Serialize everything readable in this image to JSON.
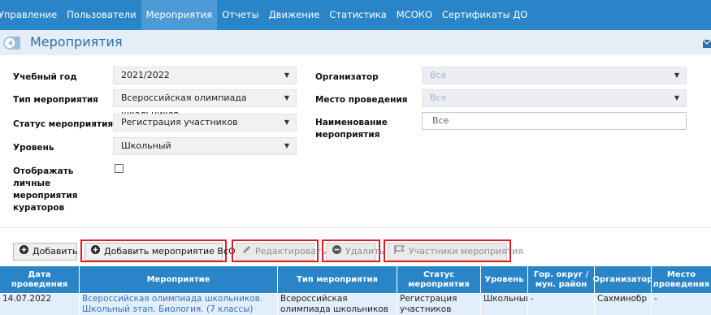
{
  "nav": {
    "items": [
      "Управление",
      "Пользователи",
      "Мероприятия",
      "Отчеты",
      "Движение",
      "Статистика",
      "МСОКО",
      "Сертификаты ДО"
    ],
    "active_index": 2
  },
  "page": {
    "title": "Мероприятия"
  },
  "filters": {
    "year_label": "Учебный год",
    "year_value": "2021/2022",
    "type_label": "Тип мероприятия",
    "type_value": "Всероссийская олимпиада школьников",
    "status_label": "Статус мероприятия",
    "status_value": "Регистрация участников",
    "level_label": "Уровень",
    "level_value": "Школьный",
    "curator_label": "Отображать личные мероприятия кураторов",
    "curator_checked": false,
    "organizer_label": "Организатор",
    "organizer_value": "Все",
    "venue_label": "Место проведения",
    "venue_value": "Все",
    "name_label": "Наименование мероприятия",
    "name_value": "Все"
  },
  "toolbar": {
    "add": "Добавить",
    "add_vsosh": "Добавить мероприятие ВсОШ",
    "edit": "Редактировать",
    "delete": "Удалить",
    "participants": "Участники мероприятия"
  },
  "table": {
    "headers": [
      "Дата проведения",
      "Мероприятие",
      "Тип мероприятия",
      "Статус мероприятия",
      "Уровень",
      "Гор. округ / мун. район",
      "Организатор",
      "Место проведения"
    ],
    "rows": [
      {
        "date": "14.07.2022",
        "event": "Всероссийская олимпиада школьников. Школьный этап. Биология. (7 классы)",
        "type": "Всероссийская олимпиада школьников",
        "status": "Регистрация участников",
        "level": "Школьный",
        "district": "-",
        "organizer": "Сахминобр",
        "venue": "-"
      }
    ]
  },
  "colors": {
    "accent": "#2a85c8",
    "highlight_border": "#e01b24",
    "row_bg": "#e3eefb"
  }
}
